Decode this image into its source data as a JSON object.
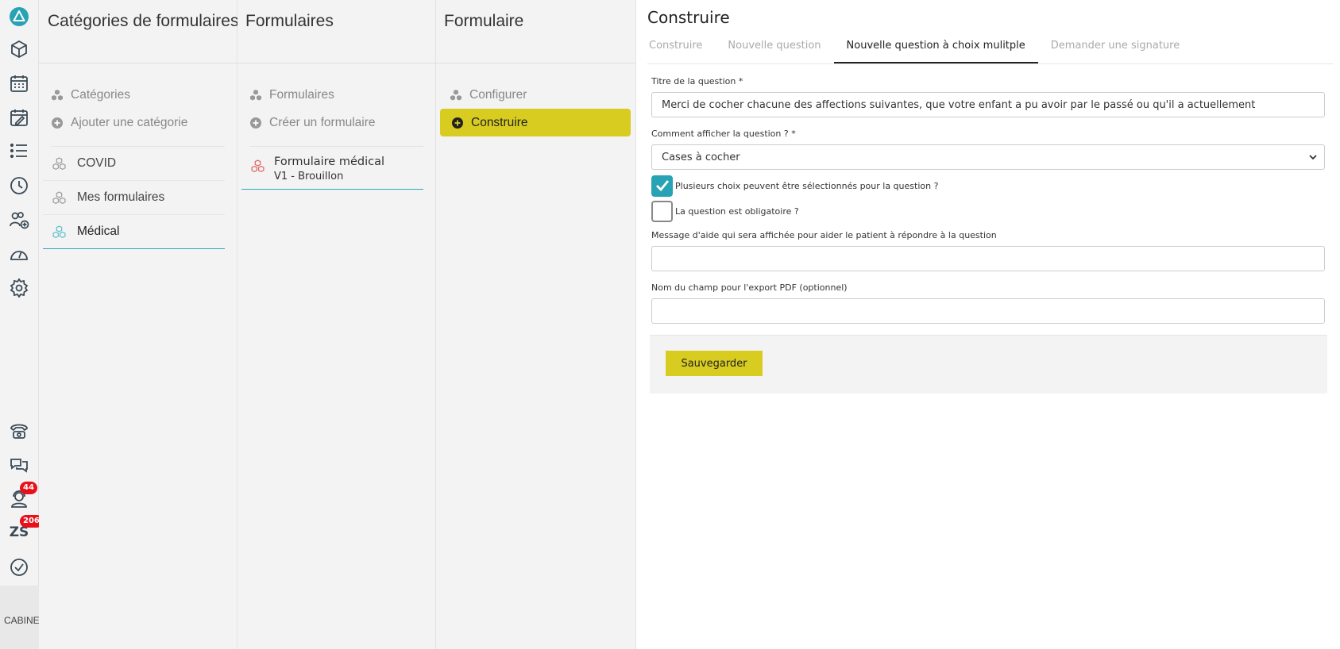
{
  "rail": {
    "badges": {
      "agenda_count": "44",
      "zs_count": "206"
    },
    "zs_label": "ZS",
    "footer_label": "CABINET"
  },
  "columns": {
    "categories": {
      "title": "Catégories de formulaires",
      "menu": [
        "Catégories",
        "Ajouter une catégorie"
      ],
      "items": [
        "COVID",
        "Mes formulaires",
        "Médical"
      ],
      "active_item": "Médical"
    },
    "forms": {
      "title": "Formulaires",
      "menu": [
        "Formulaires",
        "Créer un formulaire"
      ],
      "items": [
        {
          "name": "Formulaire médical",
          "version": "V1 - Brouillon"
        }
      ]
    },
    "form": {
      "title": "Formulaire",
      "menu": [
        "Configurer",
        "Construire"
      ],
      "active_item": "Construire"
    }
  },
  "main": {
    "title": "Construire",
    "tabs": [
      "Construire",
      "Nouvelle question",
      "Nouvelle question à choix mulitple",
      "Demander une signature"
    ],
    "active_tab": "Nouvelle question à choix mulitple",
    "fields": {
      "question_title": {
        "label": "Titre de la question *",
        "value": "Merci de cocher chacune des affections suivantes, que votre enfant a pu avoir par le passé ou qu'il a actuellement"
      },
      "display_mode": {
        "label": "Comment afficher la question ? *",
        "value": "Cases à cocher"
      },
      "multiple_choice": {
        "label": "Plusieurs choix peuvent être sélectionnés pour la question ?",
        "checked": true
      },
      "mandatory": {
        "label": "La question est obligatoire ?",
        "checked": false
      },
      "help_message": {
        "label": "Message d'aide qui sera affichée pour aider le patient à répondre à la question",
        "value": ""
      },
      "pdf_field": {
        "label": "Nom du champ pour l'export PDF (optionnel)",
        "value": ""
      }
    },
    "save_label": "Sauvegarder"
  },
  "colors": {
    "accent_yellow": "#d8cc20",
    "teal": "#27a3b3",
    "badge_red": "#e8101a"
  }
}
